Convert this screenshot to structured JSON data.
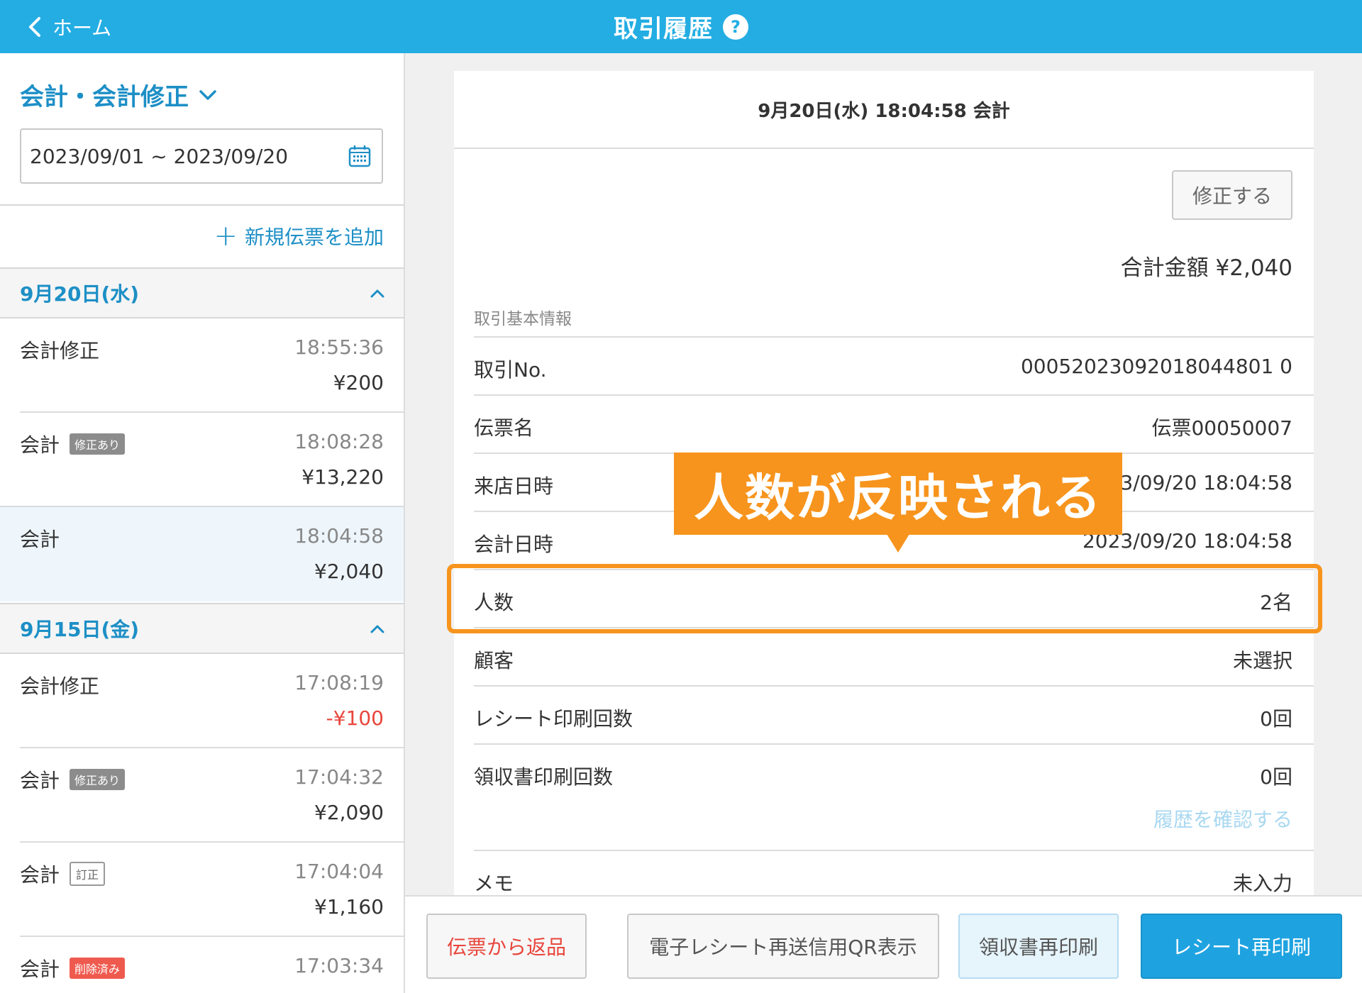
{
  "header": {
    "back_label": "ホーム",
    "title": "取引履歴",
    "help_label": "?"
  },
  "sidebar": {
    "filter_label": "会計・会計修正",
    "date_range": "2023/09/01 ~ 2023/09/20",
    "add_new_label": "新規伝票を追加",
    "groups": [
      {
        "date": "9月20日(水)",
        "items": [
          {
            "name": "会計修正",
            "badge": "",
            "time": "18:55:36",
            "amount": "¥200"
          },
          {
            "name": "会計",
            "badge": "修正あり",
            "time": "18:08:28",
            "amount": "¥13,220"
          },
          {
            "name": "会計",
            "badge": "",
            "time": "18:04:58",
            "amount": "¥2,040"
          }
        ]
      },
      {
        "date": "9月15日(金)",
        "items": [
          {
            "name": "会計修正",
            "badge": "",
            "time": "17:08:19",
            "amount": "-¥100"
          },
          {
            "name": "会計",
            "badge": "修正あり",
            "time": "17:04:32",
            "amount": "¥2,090"
          },
          {
            "name": "会計",
            "badge": "訂正",
            "time": "17:04:04",
            "amount": "¥1,160"
          },
          {
            "name": "会計",
            "badge": "削除済み",
            "time": "17:03:34",
            "amount": ""
          }
        ]
      }
    ]
  },
  "detail": {
    "heading": "9月20日(水) 18:04:58 会計",
    "edit_label": "修正する",
    "total_label": "合計金額 ¥2,040",
    "section_label": "取引基本情報",
    "rows": [
      {
        "label": "取引No.",
        "value": "00052023092018044801 0"
      },
      {
        "label": "伝票名",
        "value": "伝票00050007"
      },
      {
        "label": "来店日時",
        "value": "2023/09/20 18:04:58"
      },
      {
        "label": "会計日時",
        "value": "2023/09/20 18:04:58"
      },
      {
        "label": "人数",
        "value": "2名"
      },
      {
        "label": "顧客",
        "value": "未選択"
      },
      {
        "label": "レシート印刷回数",
        "value": "0回"
      },
      {
        "label": "領収書印刷回数",
        "value": "0回"
      },
      {
        "label": "メモ",
        "value": "未入力"
      }
    ],
    "history_link": "履歴を確認する"
  },
  "annotation": {
    "callout_text": "人数が反映される"
  },
  "footer": {
    "return_label": "伝票から返品",
    "qr_label": "電子レシート再送信用QR表示",
    "receipt_label": "領収書再印刷",
    "reprint_label": "レシート再印刷"
  },
  "colors": {
    "header_bg": "#23ade3",
    "accent_blue": "#1d8fc6",
    "annotation_orange": "#f7941d",
    "negative_red": "#e8463c",
    "primary_button": "#1fa3e0"
  }
}
